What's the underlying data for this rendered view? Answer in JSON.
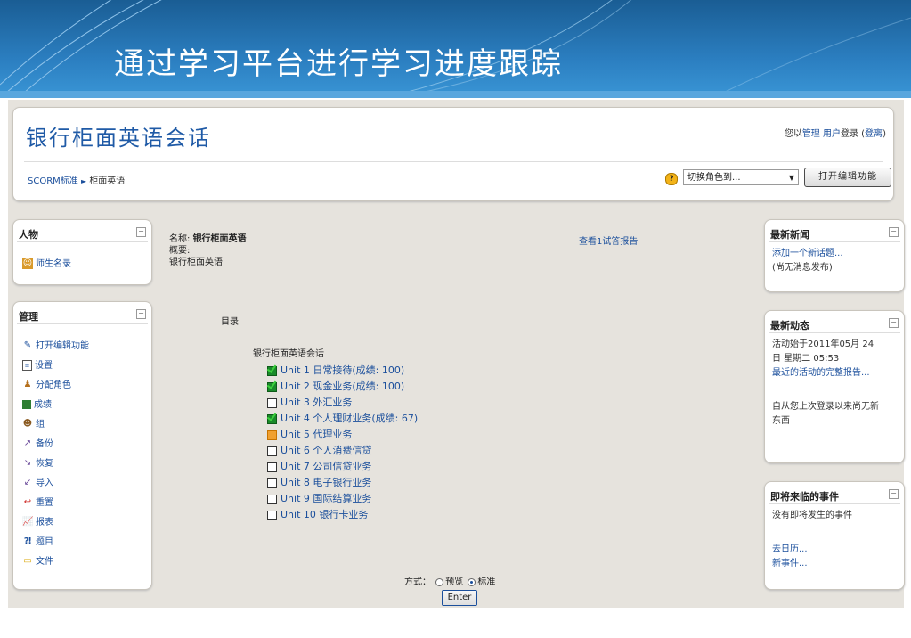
{
  "slide_title": "通过学习平台进行学习进度跟踪",
  "site": {
    "title": "银行柜面英语会话",
    "login_prefix": "您以",
    "login_user": "管理 用户",
    "login_mid": "登录 (",
    "logout": "登离",
    "login_suffix": ")"
  },
  "breadcrumb": {
    "root": "SCORM标准",
    "sep": "►",
    "current": "柜面英语"
  },
  "role_select": {
    "value": "切换角色到...",
    "arrow": "▼"
  },
  "help_icon": "?",
  "edit_button": "打开编辑功能",
  "people_block": {
    "title": "人物",
    "toggle": "−",
    "items": [
      {
        "label": "师生名录",
        "icon": "participants-icon"
      }
    ]
  },
  "admin_block": {
    "title": "管理",
    "toggle": "−",
    "items": [
      {
        "label": "打开编辑功能",
        "icon": "edit-icon"
      },
      {
        "label": "设置",
        "icon": "settings-icon"
      },
      {
        "label": "分配角色",
        "icon": "roles-icon"
      },
      {
        "label": "成绩",
        "icon": "grades-icon"
      },
      {
        "label": "组",
        "icon": "groups-icon"
      },
      {
        "label": "备份",
        "icon": "backup-icon"
      },
      {
        "label": "恢复",
        "icon": "restore-icon"
      },
      {
        "label": "导入",
        "icon": "import-icon"
      },
      {
        "label": "重置",
        "icon": "reset-icon"
      },
      {
        "label": "报表",
        "icon": "reports-icon"
      },
      {
        "label": "题目",
        "icon": "questions-icon"
      },
      {
        "label": "文件",
        "icon": "files-icon"
      }
    ]
  },
  "main": {
    "name_label": "名称: ",
    "name_value": "银行柜面英语",
    "summary_label": "概要:",
    "summary_value": "银行柜面英语",
    "report_link": "查看1试答报告",
    "toc_label": "目录",
    "toc_course": "银行柜面英语会话",
    "units": [
      {
        "label": "Unit 1 日常接待(成绩: 100)",
        "status": "done"
      },
      {
        "label": "Unit 2 现金业务(成绩: 100)",
        "status": "done"
      },
      {
        "label": "Unit 3 外汇业务",
        "status": "none"
      },
      {
        "label": "Unit 4 个人理财业务(成绩: 67)",
        "status": "done"
      },
      {
        "label": "Unit 5 代理业务",
        "status": "incomplete"
      },
      {
        "label": "Unit 6 个人消费信贷",
        "status": "none"
      },
      {
        "label": "Unit 7 公司信贷业务",
        "status": "none"
      },
      {
        "label": "Unit 8 电子银行业务",
        "status": "none"
      },
      {
        "label": "Unit 9 国际结算业务",
        "status": "none"
      },
      {
        "label": "Unit 10 银行卡业务",
        "status": "none"
      }
    ],
    "mode_label": "方式：",
    "mode_preview": "预览",
    "mode_normal": "标准",
    "enter_button": "Enter"
  },
  "news_block": {
    "title": "最新新闻",
    "toggle": "−",
    "add_link": "添加一个新话题...",
    "empty": "(尚无消息发布)"
  },
  "activity_block": {
    "title": "最新动态",
    "toggle": "−",
    "since_line1": "活动始于2011年05月 24",
    "since_line2": "日 星期二 05:53",
    "full_report": "最近的活动的完整报告...",
    "nothing1": "自从您上次登录以来尚无新",
    "nothing2": "东西"
  },
  "events_block": {
    "title": "即将来临的事件",
    "toggle": "−",
    "none": "没有即将发生的事件",
    "calendar_link": "去日历...",
    "new_event_link": "新事件..."
  }
}
